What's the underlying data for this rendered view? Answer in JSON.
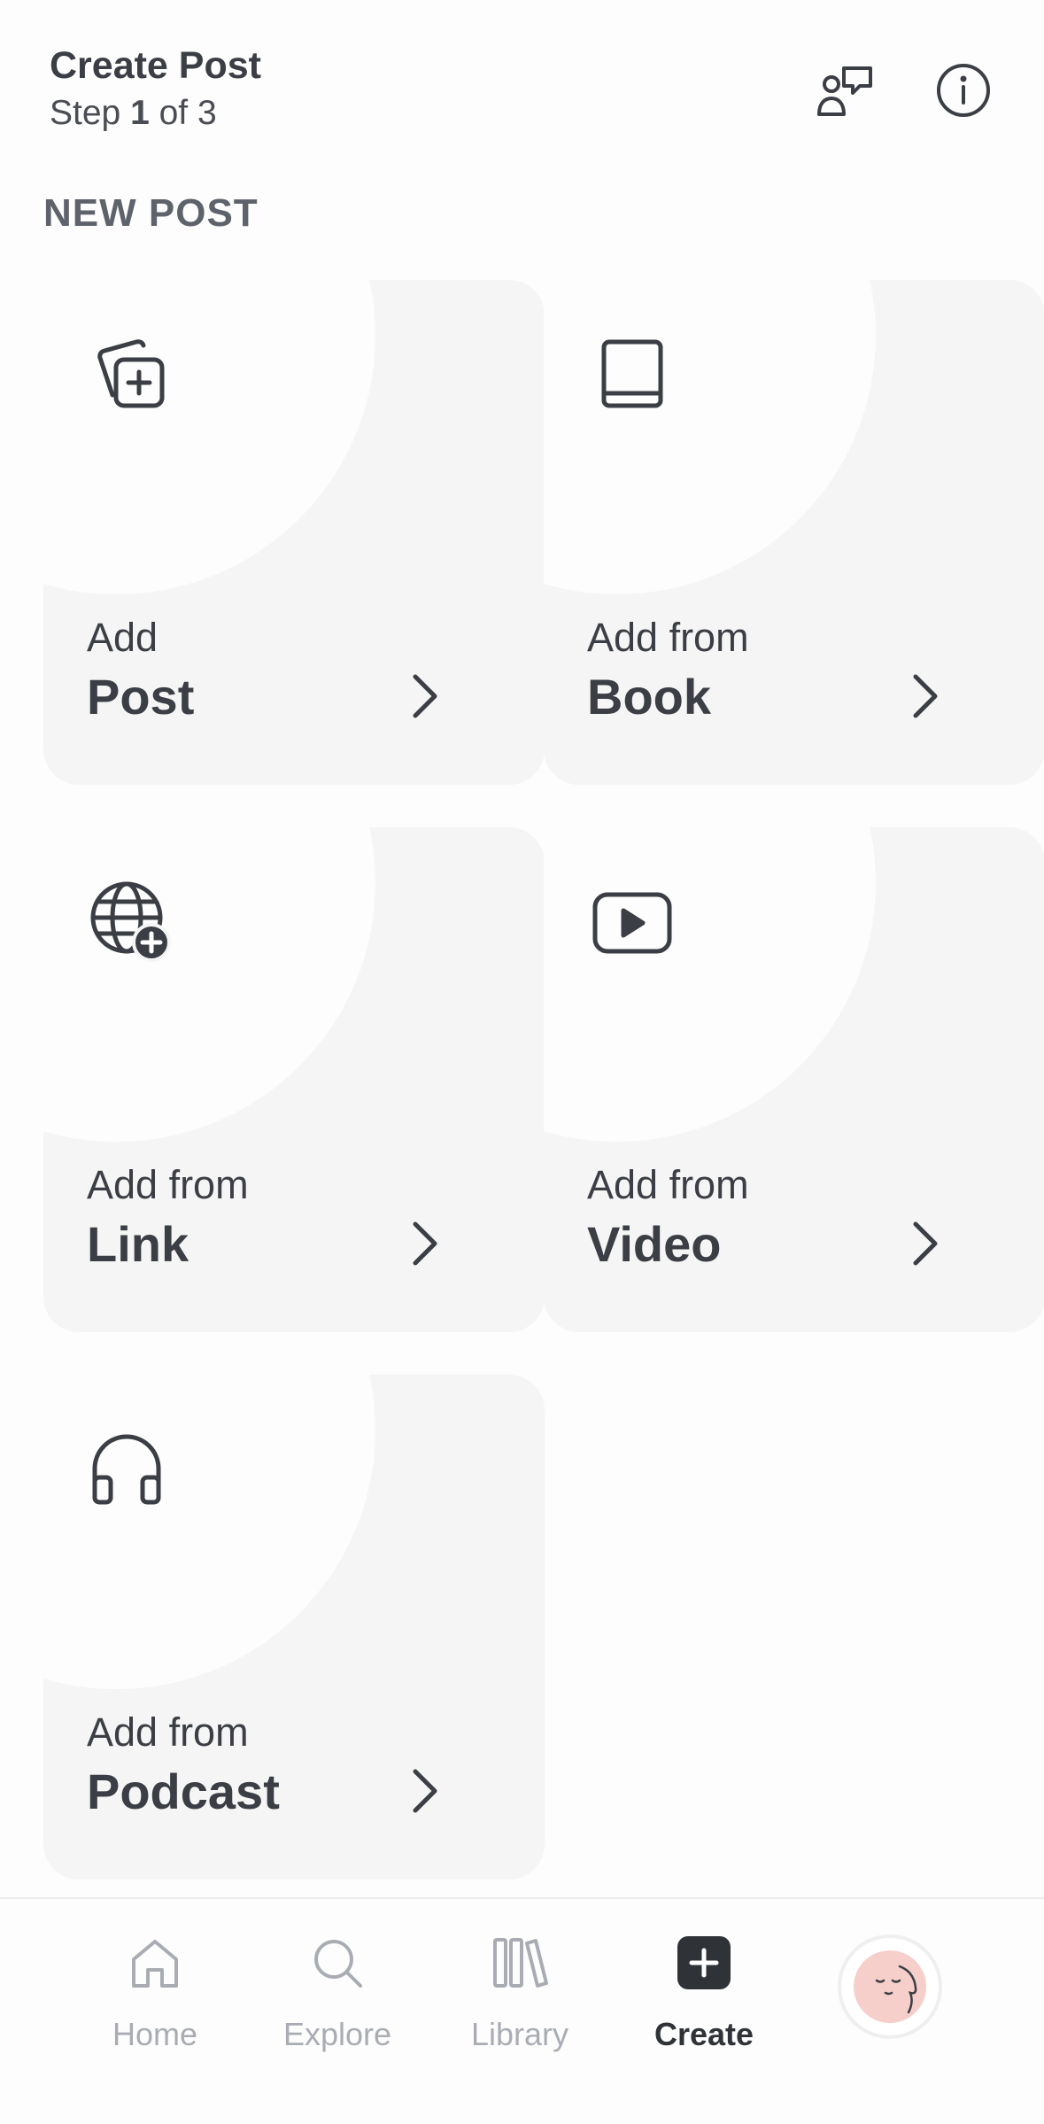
{
  "header": {
    "title": "Create Post",
    "step_prefix": "Step ",
    "step_current": "1",
    "step_suffix": " of 3",
    "feedback_icon": "chat-bubbles-icon",
    "info_icon": "info-icon"
  },
  "section_label": "NEW POST",
  "cards": [
    {
      "sub": "Add",
      "main": "Post",
      "icon": "add-post-icon"
    },
    {
      "sub": "Add from",
      "main": "Book",
      "icon": "book-icon"
    },
    {
      "sub": "Add from",
      "main": "Link",
      "icon": "globe-plus-icon"
    },
    {
      "sub": "Add from",
      "main": "Video",
      "icon": "video-play-icon"
    },
    {
      "sub": "Add from",
      "main": "Podcast",
      "icon": "headphones-icon"
    }
  ],
  "nav": {
    "home": "Home",
    "explore": "Explore",
    "library": "Library",
    "create": "Create",
    "active": "Create"
  },
  "colors": {
    "text": "#3b3e44",
    "card_bg": "#f5f5f5",
    "nav_inactive": "#a9adb3",
    "avatar_bg": "#f6cfca"
  }
}
